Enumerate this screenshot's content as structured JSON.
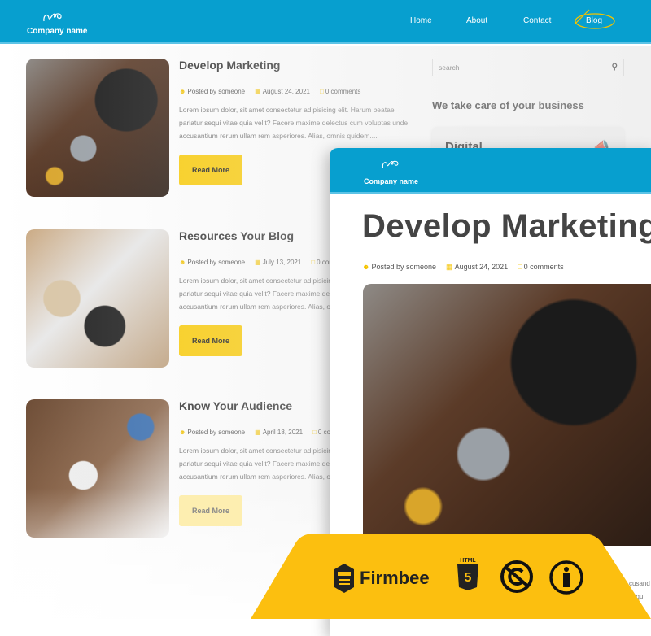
{
  "header": {
    "company_name": "Company name",
    "nav": [
      "Home",
      "About",
      "Contact",
      "Blog"
    ],
    "active": "Blog",
    "brand_color": "#079fcf",
    "accent_color": "#fccd0a"
  },
  "posts": [
    {
      "title": "Develop Marketing",
      "author": "Posted by someone",
      "date": "August 24, 2021",
      "comments": "0 comments",
      "excerpt": "Lorem ipsum dolor, sit amet consectetur adipisicing elit. Harum beatae pariatur sequi vitae quia velit? Facere maxime delectus cum voluptas unde accusantium rerum ullam rem asperiores. Alias, omnis quidem....",
      "button": "Read More"
    },
    {
      "title": "Resources Your Blog",
      "author": "Posted by someone",
      "date": "July 13, 2021",
      "comments": "0 comments",
      "excerpt": "Lorem ipsum dolor, sit amet consectetur adipisicing elit. Harum beatae pariatur sequi vitae quia velit? Facere maxime delectus cum voluptas unde accusantium rerum ullam rem asperiores. Alias, omnis quidem....",
      "button": "Read More"
    },
    {
      "title": "Know Your Audience",
      "author": "Posted by someone",
      "date": "April 18, 2021",
      "comments": "0 comments",
      "excerpt": "Lorem ipsum dolor, sit amet consectetur adipisicing elit. Harum beatae pariatur sequi vitae quia velit? Facere maxime delectus cum voluptas unde accusantium rerum ullam rem asperiores. Alias, omnis quidem....",
      "button": "Read More"
    }
  ],
  "sidebar": {
    "search_placeholder": "search",
    "title": "We take care of your business",
    "card_title": "Digital"
  },
  "overlay": {
    "company_name": "Company name",
    "title": "Develop Marketing",
    "author": "Posted by someone",
    "date": "August 24, 2021",
    "comments": "0 comments",
    "text": "cusand\nid qu\np."
  },
  "banner": {
    "brand": "Firmbee",
    "html_label": "HTML",
    "html_version": "5",
    "icons": [
      "firmbee-logo-icon",
      "html5-icon",
      "no-copyright-icon",
      "accessibility-icon"
    ]
  }
}
